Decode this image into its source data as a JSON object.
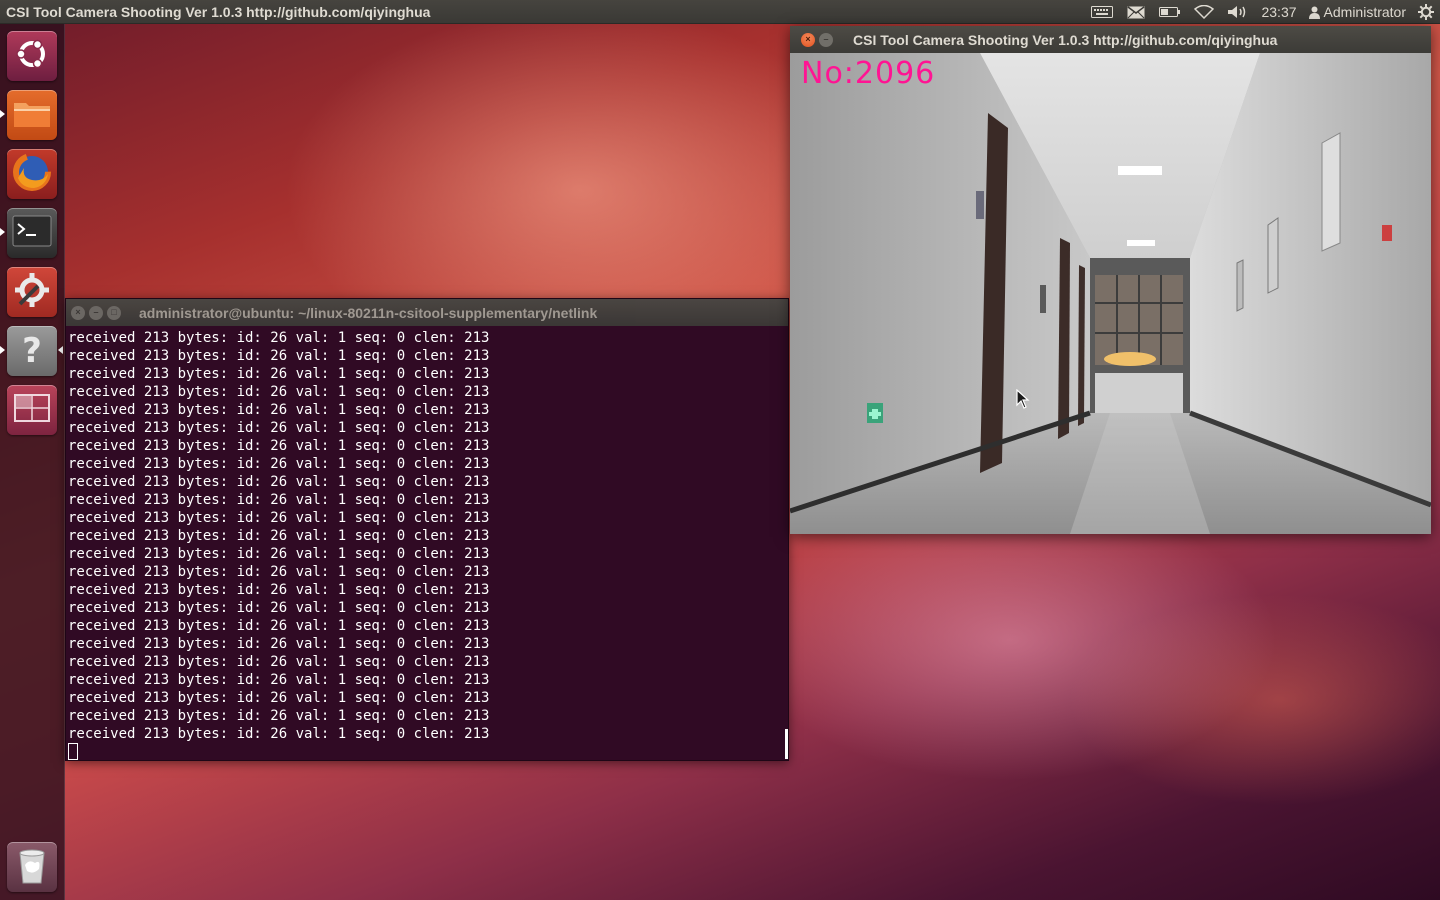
{
  "top_panel": {
    "app_title": "CSI Tool Camera Shooting Ver 1.0.3  http://github.com/qiyinghua",
    "clock": "23:37",
    "user_name": "Administrator",
    "indicator_icons": [
      "keyboard-icon",
      "mail-icon",
      "battery-icon",
      "wifi-icon",
      "volume-icon",
      "user-icon",
      "gear-icon"
    ]
  },
  "launcher": {
    "items": [
      {
        "name": "dash-home",
        "icon": "ubuntu-logo-icon"
      },
      {
        "name": "files",
        "icon": "folder-icon"
      },
      {
        "name": "firefox",
        "icon": "firefox-icon"
      },
      {
        "name": "terminal",
        "icon": "terminal-icon"
      },
      {
        "name": "system-settings",
        "icon": "settings-icon"
      },
      {
        "name": "help",
        "icon": "help-icon",
        "glyph": "?"
      },
      {
        "name": "workspace-switcher",
        "icon": "workspaces-icon"
      },
      {
        "name": "trash",
        "icon": "trash-icon"
      }
    ]
  },
  "terminal": {
    "title": "administrator@ubuntu: ~/linux-80211n-csitool-supplementary/netlink",
    "lines": [
      "received 213 bytes: id: 26 val: 1 seq: 0 clen: 213",
      "received 213 bytes: id: 26 val: 1 seq: 0 clen: 213",
      "received 213 bytes: id: 26 val: 1 seq: 0 clen: 213",
      "received 213 bytes: id: 26 val: 1 seq: 0 clen: 213",
      "received 213 bytes: id: 26 val: 1 seq: 0 clen: 213",
      "received 213 bytes: id: 26 val: 1 seq: 0 clen: 213",
      "received 213 bytes: id: 26 val: 1 seq: 0 clen: 213",
      "received 213 bytes: id: 26 val: 1 seq: 0 clen: 213",
      "received 213 bytes: id: 26 val: 1 seq: 0 clen: 213",
      "received 213 bytes: id: 26 val: 1 seq: 0 clen: 213",
      "received 213 bytes: id: 26 val: 1 seq: 0 clen: 213",
      "received 213 bytes: id: 26 val: 1 seq: 0 clen: 213",
      "received 213 bytes: id: 26 val: 1 seq: 0 clen: 213",
      "received 213 bytes: id: 26 val: 1 seq: 0 clen: 213",
      "received 213 bytes: id: 26 val: 1 seq: 0 clen: 213",
      "received 213 bytes: id: 26 val: 1 seq: 0 clen: 213",
      "received 213 bytes: id: 26 val: 1 seq: 0 clen: 213",
      "received 213 bytes: id: 26 val: 1 seq: 0 clen: 213",
      "received 213 bytes: id: 26 val: 1 seq: 0 clen: 213",
      "received 213 bytes: id: 26 val: 1 seq: 0 clen: 213",
      "received 213 bytes: id: 26 val: 1 seq: 0 clen: 213",
      "received 213 bytes: id: 26 val: 1 seq: 0 clen: 213",
      "received 213 bytes: id: 26 val: 1 seq: 0 clen: 213"
    ]
  },
  "camera_window": {
    "title": "CSI Tool Camera Shooting Ver 1.0.3  http://github.com/qiyinghua",
    "frame_counter": "No:2096",
    "counter_color": "#ff1493"
  },
  "colors": {
    "terminal_bg": "#300a24",
    "panel_bg": "#3c3b37",
    "close_button": "#e0501f"
  }
}
